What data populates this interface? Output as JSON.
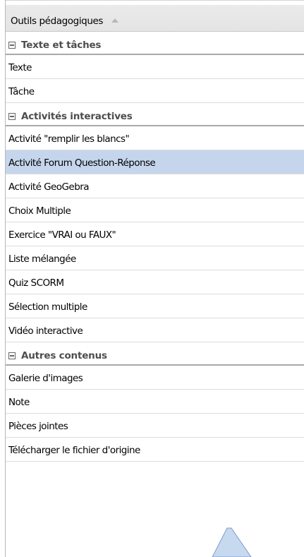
{
  "panel": {
    "title": "Outils pédagogiques",
    "sections": [
      {
        "label": "Texte et tâches",
        "items": [
          "Texte",
          "Tâche"
        ]
      },
      {
        "label": "Activités interactives",
        "items": [
          "Activité \"remplir les blancs\"",
          "Activité Forum Question-Réponse",
          "Activité GeoGebra",
          "Choix Multiple",
          "Exercice \"VRAI ou FAUX\"",
          "Liste mélangée",
          "Quiz SCORM",
          "Sélection multiple",
          "Vidéo interactive"
        ]
      },
      {
        "label": "Autres contenus",
        "items": [
          "Galerie d'images",
          "Note",
          "Pièces jointes",
          "Télécharger le fichier d'origine"
        ]
      }
    ],
    "selected_item": "Activité Forum Question-Réponse"
  },
  "icons": {
    "header_sort": "sort-up-icon",
    "section_toggle": "collapse-icon"
  },
  "colors": {
    "selected_bg": "#c5d5ec",
    "header_bg": "#e6e6e6",
    "section_text": "#4d4d4d"
  }
}
